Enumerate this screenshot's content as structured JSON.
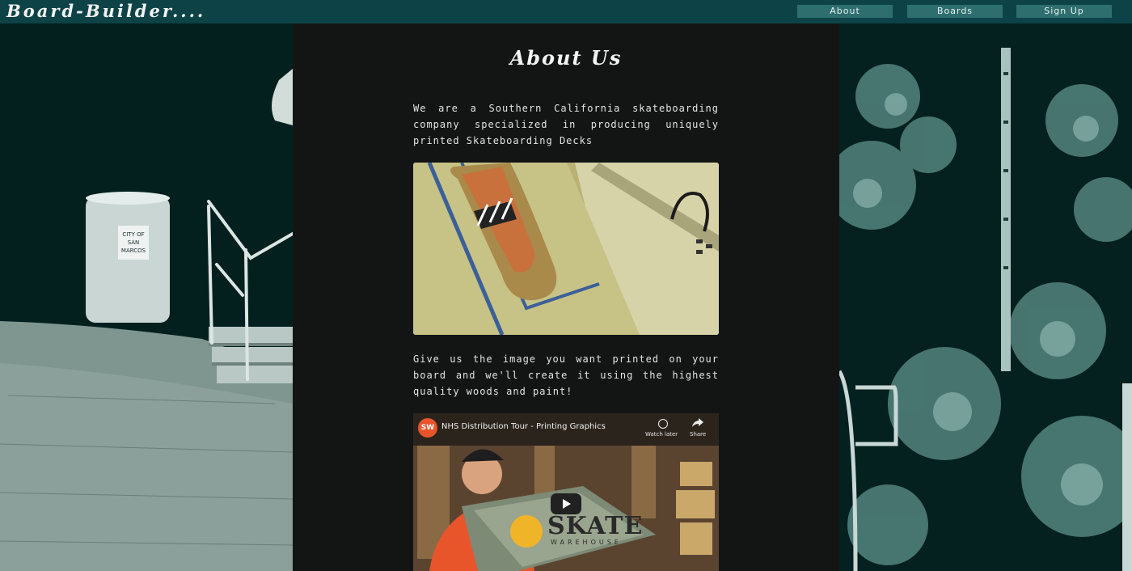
{
  "nav": {
    "logo": "Board-Builder....",
    "links": [
      "About",
      "Boards",
      "Sign Up"
    ]
  },
  "about": {
    "heading": "About Us",
    "intro": "We are a Southern California skateboarding company specialized in producing uniquely printed Skateboarding Decks",
    "pitch": "Give us the image you want printed on your board and we'll create it using the highest quality woods and paint!"
  },
  "video": {
    "channel_badge": "SW",
    "title": "NHS Distribution Tour - Printing Graphics",
    "watch_later": "Watch later",
    "share": "Share",
    "brand": "SKATE",
    "brand_sub": "WAREHOUSE"
  },
  "background": {
    "sign_text": "CITY OF SAN MARCOS"
  },
  "colors": {
    "topbar": "#0d4347",
    "nav_button": "#2e6e6f",
    "content_panel": "#121514"
  }
}
